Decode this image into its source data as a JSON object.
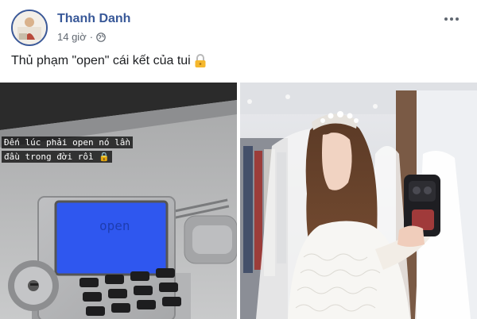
{
  "post": {
    "author": "Thanh Danh",
    "time": "14 giờ",
    "separator": "·",
    "privacy_icon": "globe-icon",
    "more_icon": "ellipsis-icon",
    "caption": "Thủ phạm \"open\" cái kết của tui",
    "caption_emoji": "lock-icon"
  },
  "photos": {
    "left": {
      "overlay_line1": "Đến lúc phải open nó lần",
      "overlay_line2": "đầu trong đời rồi 🔒"
    },
    "right": {}
  },
  "colors": {
    "author_link": "#385898",
    "meta_text": "#606770",
    "lcd_screen": "#2f57ef"
  }
}
